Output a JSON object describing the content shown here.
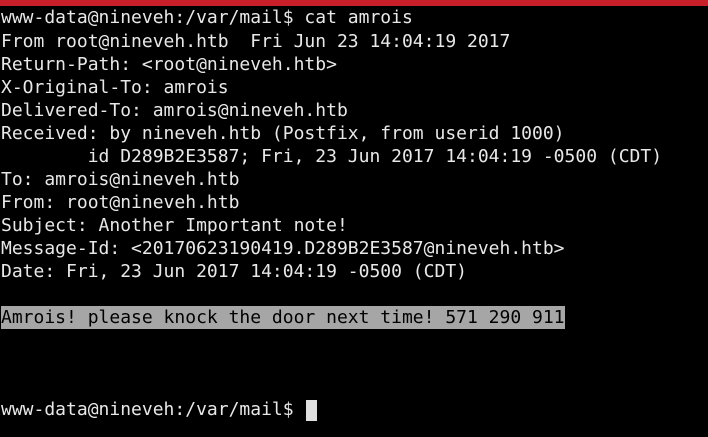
{
  "terminal": {
    "command_line": "www-data@nineveh:/var/mail$ cat amrois",
    "mail_lines": [
      "From root@nineveh.htb  Fri Jun 23 14:04:19 2017",
      "Return-Path: <root@nineveh.htb>",
      "X-Original-To: amrois",
      "Delivered-To: amrois@nineveh.htb",
      "Received: by nineveh.htb (Postfix, from userid 1000)",
      "        id D289B2E3587; Fri, 23 Jun 2017 14:04:19 -0500 (CDT)",
      "To: amrois@nineveh.htb",
      "From: root@nineveh.htb",
      "Subject: Another Important note!",
      "Message-Id: <20170623190419.D289B2E3587@nineveh.htb>",
      "Date: Fri, 23 Jun 2017 14:04:19 -0500 (CDT)"
    ],
    "highlighted_body": "Amrois! please knock the door next time! 571 290 911",
    "prompt": "www-data@nineveh:/var/mail$ "
  },
  "colors": {
    "background": "#000000",
    "text": "#e8e8e8",
    "highlight_bg": "#a6a6a6",
    "highlight_text": "#000000",
    "top_border": "#c8202a"
  }
}
